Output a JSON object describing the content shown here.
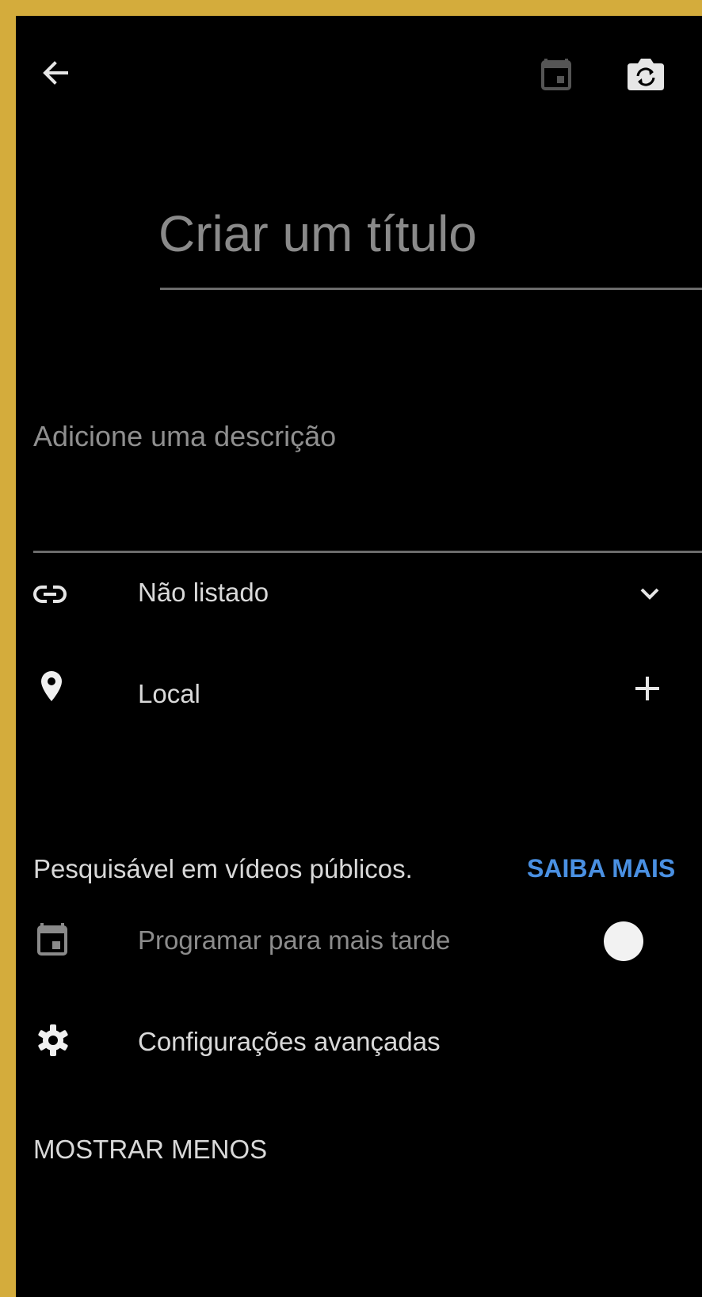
{
  "header": {
    "back_icon": "arrow-left-icon",
    "schedule_icon": "calendar-icon",
    "thumbnail_icon": "camera-switch-icon"
  },
  "title_field": {
    "placeholder": "Criar um título"
  },
  "description_field": {
    "placeholder": "Adicione uma descrição"
  },
  "visibility": {
    "icon": "link-icon",
    "label": "Não listado",
    "action_icon": "chevron-down-icon"
  },
  "location": {
    "icon": "location-pin-icon",
    "label": "Local",
    "action_icon": "plus-icon"
  },
  "searchable": {
    "text": "Pesquisável em vídeos públicos.",
    "link_label": "SAIBA MAIS"
  },
  "schedule": {
    "icon": "calendar-icon",
    "label": "Programar para mais tarde",
    "enabled": false
  },
  "advanced": {
    "icon": "gear-icon",
    "label": "Configurações avançadas"
  },
  "show_less": {
    "label": "MOSTRAR MENOS"
  },
  "colors": {
    "frame": "#d4ac3c",
    "background": "#000000",
    "link": "#4a90e2"
  }
}
